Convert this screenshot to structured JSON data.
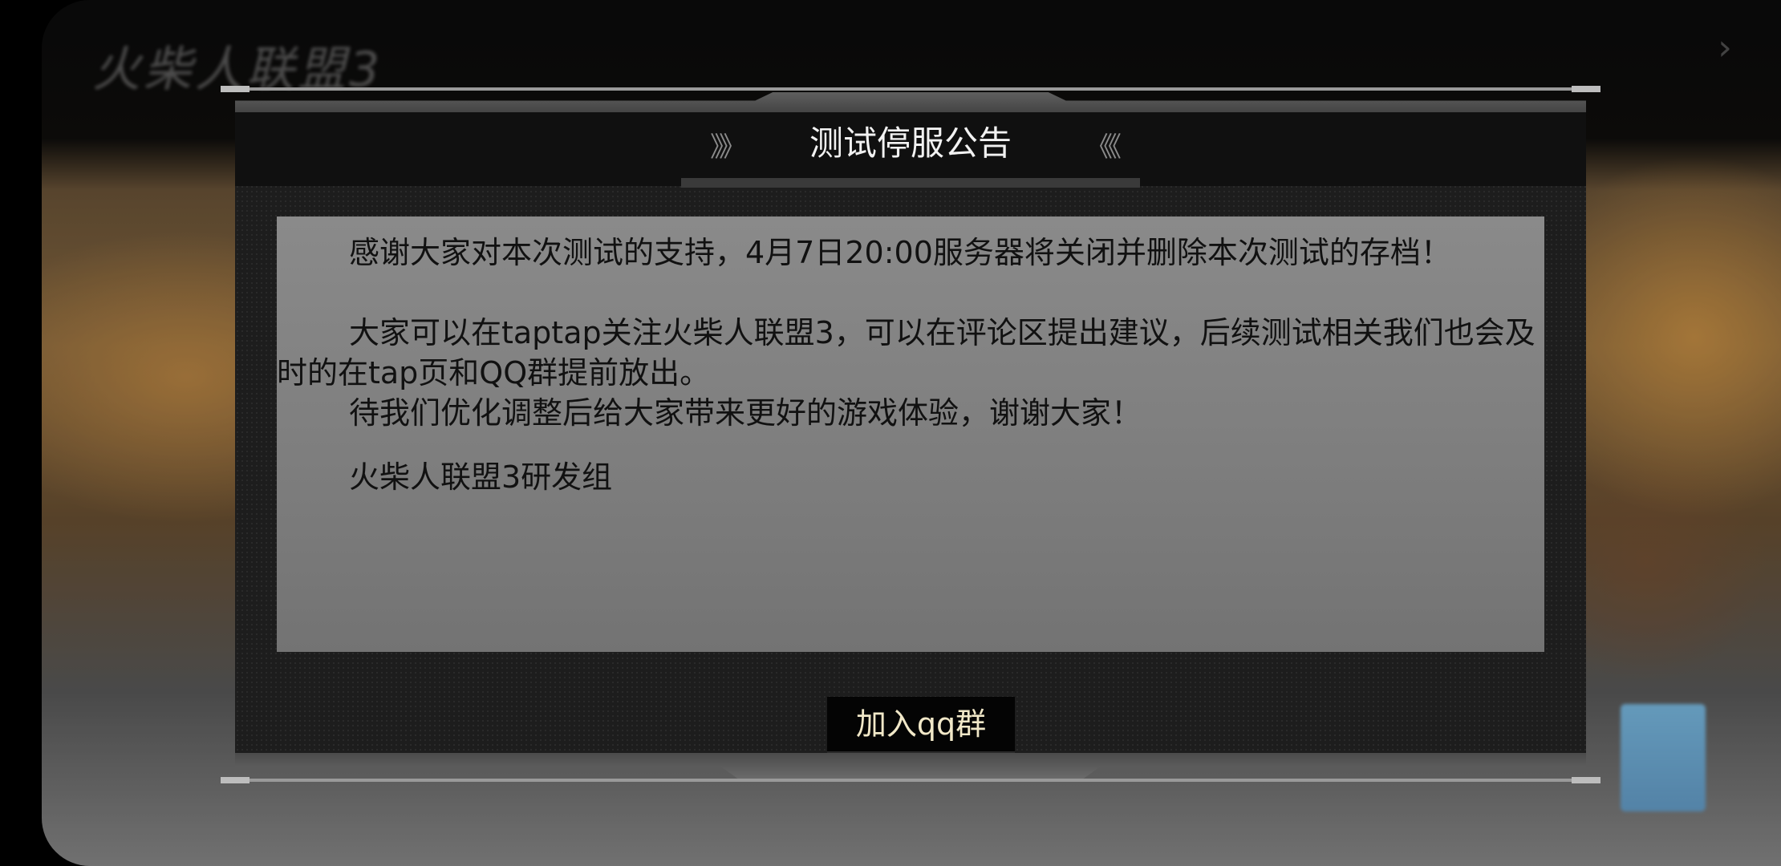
{
  "game": {
    "logo_text": "火柴人联盟3",
    "top_right_text": "",
    "top_right_arrow": "›",
    "bottom_text": ""
  },
  "dialog": {
    "title": "测试停服公告",
    "chevron_left": "》》",
    "chevron_right": "《《",
    "paragraphs": [
      "感谢大家对本次测试的支持，4月7日20:00服务器将关闭并删除本次测试的存档！",
      "大家可以在taptap关注火柴人联盟3，可以在评论区提出建议，后续测试相关我们也会及时的在tap页和QQ群提前放出。",
      "待我们优化调整后给大家带来更好的游戏体验，谢谢大家！",
      "火柴人联盟3研发组"
    ],
    "button_label": "加入qq群"
  },
  "colors": {
    "dialog_background": "#1d1d1d",
    "content_panel": "#828282",
    "button_background": "#040404",
    "button_text": "#f1e8c8"
  }
}
